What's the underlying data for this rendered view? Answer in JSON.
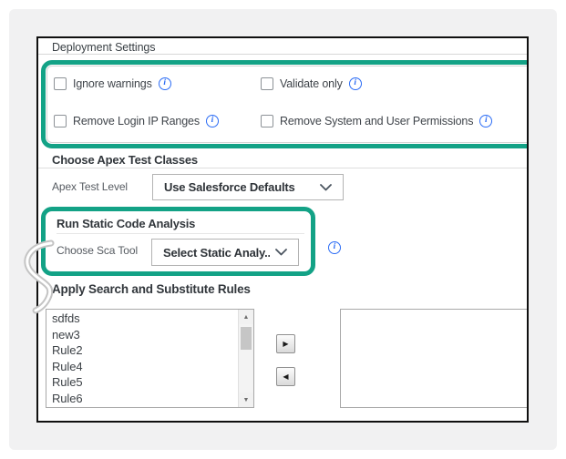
{
  "panel": {
    "title": "Deployment Settings"
  },
  "checkboxes": {
    "items": [
      {
        "label": "Ignore warnings",
        "checked": false
      },
      {
        "label": "Validate only",
        "checked": false
      },
      {
        "label": "Remove Login IP Ranges",
        "checked": false
      },
      {
        "label": "Remove System and User Permissions",
        "checked": false
      }
    ]
  },
  "apex": {
    "heading": "Choose Apex Test Classes",
    "label": "Apex Test Level",
    "value": "Use Salesforce Defaults"
  },
  "sca": {
    "heading": "Run Static Code Analysis",
    "label": "Choose Sca Tool",
    "value": "Select Static Analy.."
  },
  "rules": {
    "heading": "Apply Search and Substitute Rules",
    "available": [
      "sdfds",
      "new3",
      "Rule2",
      "Rule4",
      "Rule5",
      "Rule6"
    ],
    "selected": []
  },
  "icons": {
    "info": "i",
    "move_right": "▶",
    "move_left": "◀",
    "scroll_up": "▲",
    "scroll_down": "▼"
  },
  "colors": {
    "annotation_teal": "#13a286",
    "info_blue": "#2b6cf5",
    "panel_border": "#101010",
    "backdrop_gray": "#f1f1f2"
  }
}
